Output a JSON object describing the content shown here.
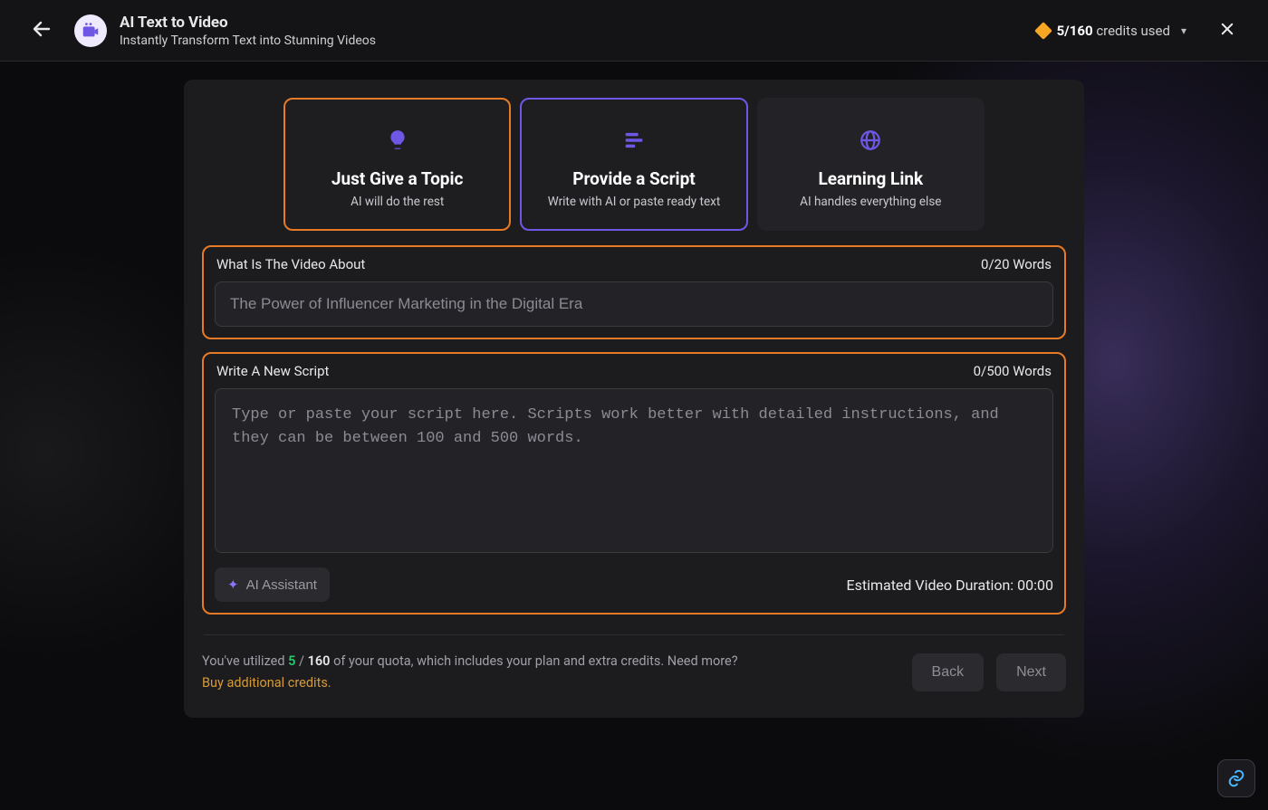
{
  "header": {
    "title": "AI Text to Video",
    "subtitle": "Instantly Transform Text into Stunning Videos",
    "credits_used": "5/160",
    "credits_label": "credits used"
  },
  "modes": [
    {
      "icon": "lightbulb-icon",
      "title": "Just Give a Topic",
      "sub": "AI will do the rest"
    },
    {
      "icon": "script-lines-icon",
      "title": "Provide a Script",
      "sub": "Write with AI or paste ready text"
    },
    {
      "icon": "globe-icon",
      "title": "Learning Link",
      "sub": "AI handles everything else"
    }
  ],
  "topic": {
    "label": "What Is The Video About",
    "counter": "0/20 Words",
    "placeholder": "The Power of Influencer Marketing in the Digital Era",
    "value": ""
  },
  "script": {
    "label": "Write A New Script",
    "counter": "0/500 Words",
    "placeholder": "Type or paste your script here. Scripts work better with detailed instructions, and they can be between 100 and 500 words.",
    "value": "",
    "ai_assist_label": "AI Assistant",
    "estimate_prefix": "Estimated Video Duration: ",
    "estimate_value": "00:00"
  },
  "quota": {
    "prefix": "You've utilized ",
    "used": "5",
    "sep": " / ",
    "total": "160",
    "suffix": " of your quota, which includes your plan and extra credits. Need more?",
    "buy_label": "Buy additional credits."
  },
  "buttons": {
    "back": "Back",
    "next": "Next"
  }
}
